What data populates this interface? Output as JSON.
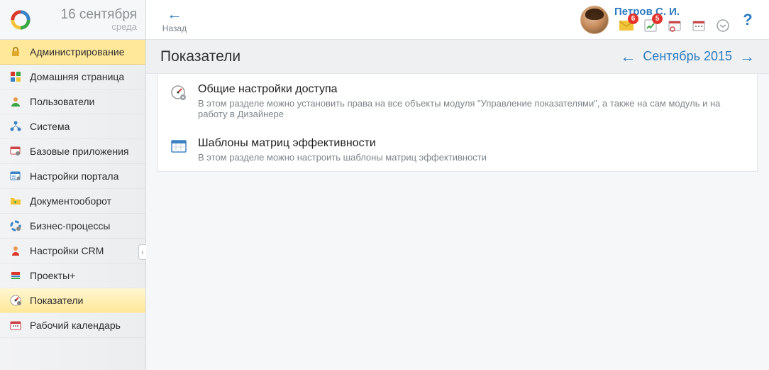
{
  "date": {
    "line1": "16 сентября",
    "line2": "среда"
  },
  "back_label": "Назад",
  "user": {
    "name": "Петров С. И."
  },
  "badges": {
    "mail": "6",
    "tasks": "5"
  },
  "nav": [
    {
      "label": "Администрирование"
    },
    {
      "label": "Домашняя страница"
    },
    {
      "label": "Пользователи"
    },
    {
      "label": "Система"
    },
    {
      "label": "Базовые приложения"
    },
    {
      "label": "Настройки портала"
    },
    {
      "label": "Документооборот"
    },
    {
      "label": "Бизнес-процессы"
    },
    {
      "label": "Настройки CRM"
    },
    {
      "label": "Проекты+"
    },
    {
      "label": "Показатели"
    },
    {
      "label": "Рабочий календарь"
    }
  ],
  "page_title": "Показатели",
  "period": "Сентябрь 2015",
  "items": [
    {
      "title": "Общие настройки доступа",
      "desc": "В этом разделе можно установить права на все объекты модуля \"Управление показателями\", а также на сам модуль и на работу в Дизайнере"
    },
    {
      "title": "Шаблоны матриц эффективности",
      "desc": "В этом разделе можно настроить шаблоны матриц эффективности"
    }
  ]
}
